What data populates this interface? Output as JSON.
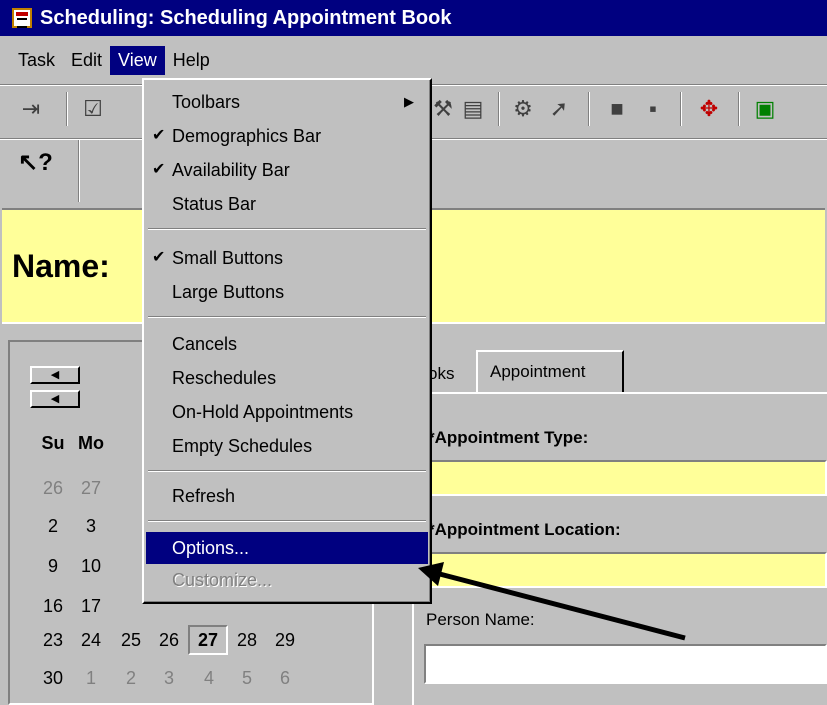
{
  "window": {
    "title": "Scheduling: Scheduling Appointment Book"
  },
  "menubar": {
    "items": [
      "Task",
      "Edit",
      "View",
      "Help"
    ]
  },
  "view_menu": {
    "toolbars": "Toolbars",
    "demographics_bar": "Demographics Bar",
    "availability_bar": "Availability Bar",
    "status_bar": "Status Bar",
    "small_buttons": "Small Buttons",
    "large_buttons": "Large Buttons",
    "cancels": "Cancels",
    "reschedules": "Reschedules",
    "on_hold": "On-Hold Appointments",
    "empty_schedules": "Empty Schedules",
    "refresh": "Refresh",
    "options": "Options...",
    "customize": "Customize..."
  },
  "demographics": {
    "name_label": "Name:"
  },
  "calendar": {
    "days_of_week": [
      "Su",
      "Mo"
    ],
    "rows": [
      [
        "26",
        "27"
      ],
      [
        "2",
        "3"
      ],
      [
        "9",
        "10"
      ],
      [
        "16",
        "17",
        "",
        "",
        "",
        "",
        ""
      ],
      [
        "23",
        "24",
        "25",
        "26",
        "27",
        "28",
        "29"
      ],
      [
        "30",
        "1",
        "2",
        "3",
        "4",
        "5",
        "6"
      ]
    ]
  },
  "appointment": {
    "tabs": [
      "oks",
      "Appointment"
    ],
    "appointment_type_label": "*Appointment Type:",
    "appointment_location_label": "*Appointment Location:",
    "person_name_label": "Person Name:"
  },
  "colors": {
    "title_bg": "#000080",
    "window_bg": "#c0c0c0",
    "highlight": "#ffff99"
  }
}
